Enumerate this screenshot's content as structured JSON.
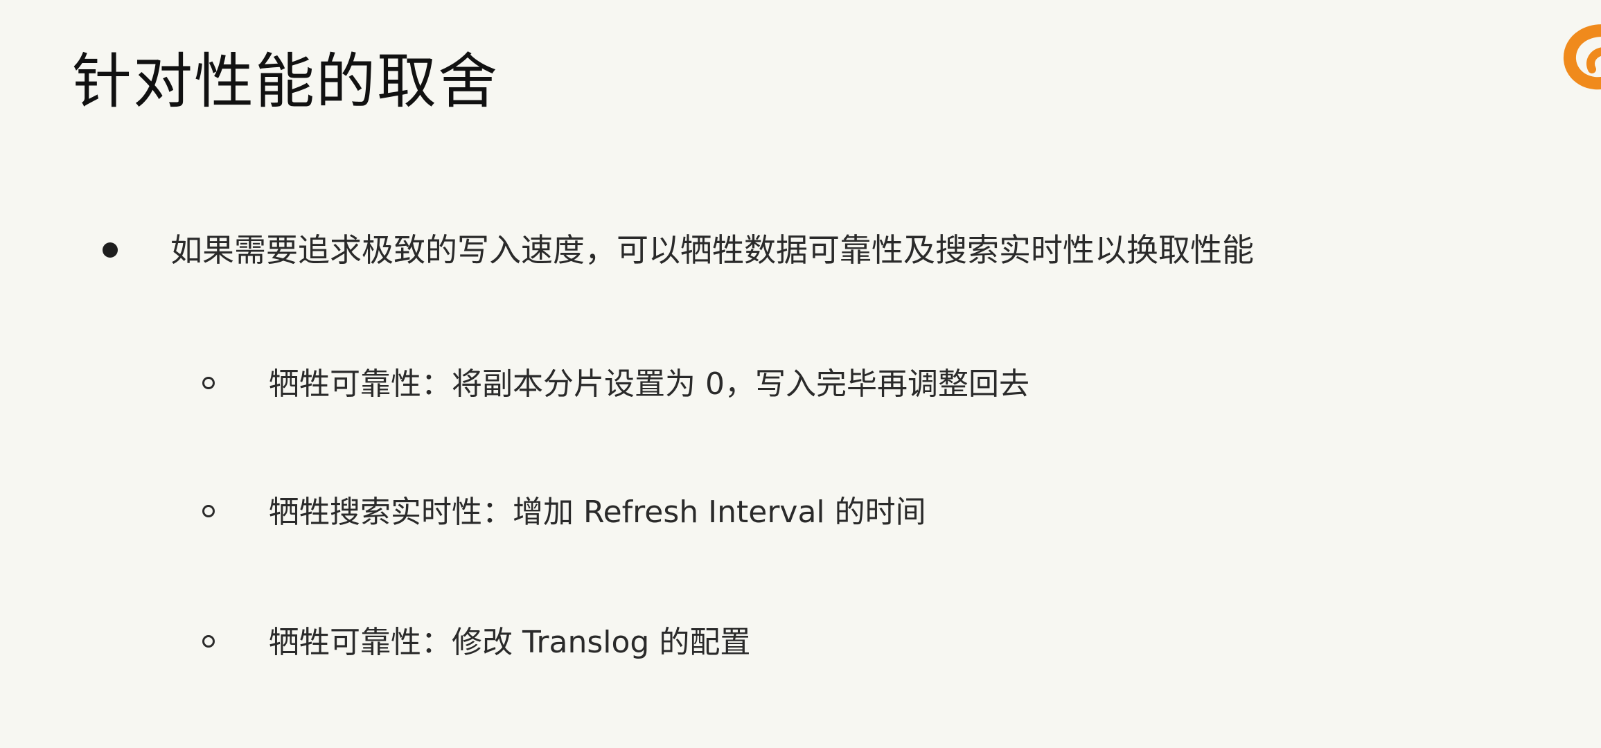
{
  "slide": {
    "title": "针对性能的取舍",
    "logo_icon": "orange-swirl-logo-icon",
    "accent_color": "#f08a1c",
    "bullets": [
      {
        "text": "如果需要追求极致的写入速度，可以牺牲数据可靠性及搜索实时性以换取性能",
        "sub_items": [
          "牺牲可靠性：将副本分片设置为 0，写入完毕再调整回去",
          "牺牲搜索实时性：增加 Refresh Interval 的时间",
          "牺牲可靠性：修改 Translog 的配置"
        ]
      }
    ]
  }
}
